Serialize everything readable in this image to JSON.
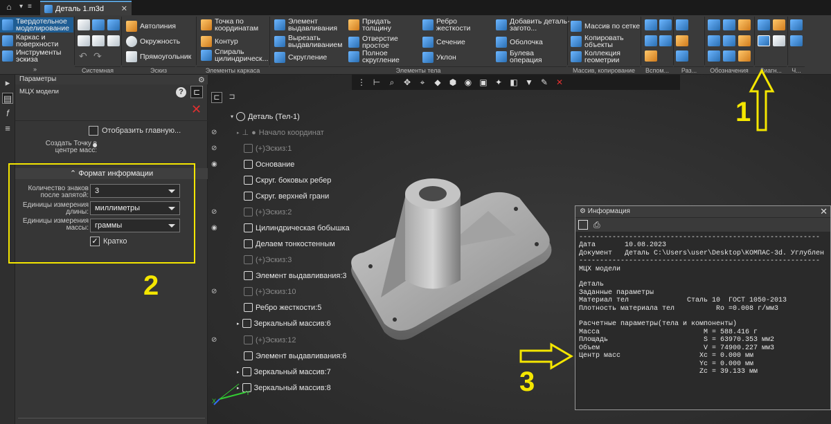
{
  "title_bar": {
    "doc_tab": "Деталь 1.m3d"
  },
  "ribbon": {
    "modes": [
      "Твердотельное моделирование",
      "Каркас и поверхности",
      "Инструменты эскиза"
    ],
    "sketch_tools": [
      "Автолиния",
      "Окружность",
      "Прямоугольник"
    ],
    "frame_tools": [
      "Точка по координатам",
      "Контур",
      "Спираль цилиндрическ..."
    ],
    "body_tools_col1": [
      "Элемент выдавливания",
      "Вырезать выдавливанием",
      "Скругление"
    ],
    "body_tools_col2": [
      "Придать толщину",
      "Отверстие простое",
      "Полное скругление"
    ],
    "body_tools_col3": [
      "Ребро жесткости",
      "Сечение",
      "Уклон"
    ],
    "body_tools_col4": [
      "Добавить деталь-загото...",
      "Оболочка",
      "Булева операция"
    ],
    "array_tools": [
      "Массив по сетке",
      "Копировать объекты",
      "Коллекция геометрии"
    ],
    "groups": [
      "Системная",
      "Эскиз",
      "Элементы каркаса",
      "Элементы тела",
      "Массив, копирование",
      "Вспом...",
      "Раз...",
      "Обозначения",
      "Диагн...",
      "Ч..."
    ]
  },
  "params": {
    "title": "Параметры",
    "subtitle": "МЦХ модели",
    "show_main": "Отобразить главную...",
    "create_point": "Создать Точку в центре масс:",
    "section": "Формат информации",
    "fields": [
      {
        "label": "Количество знаков после запятой:",
        "value": "3"
      },
      {
        "label": "Единицы измерения длины:",
        "value": "миллиметры"
      },
      {
        "label": "Единицы измерения массы:",
        "value": "граммы"
      }
    ],
    "brief": "Кратко"
  },
  "tree": {
    "root": "Деталь (Тел-1)",
    "items": [
      {
        "label": "Начало координат",
        "dim": true
      },
      {
        "label": "(+)Эскиз:1",
        "dim": true
      },
      {
        "label": "Основание",
        "dim": false
      },
      {
        "label": "Скруг. боковых ребер",
        "dim": false
      },
      {
        "label": "Скруг. верхней грани",
        "dim": false
      },
      {
        "label": "(+)Эскиз:2",
        "dim": true
      },
      {
        "label": "Цилиндрическая бобышка",
        "dim": false
      },
      {
        "label": "Делаем тонкостенным",
        "dim": false
      },
      {
        "label": "(+)Эскиз:3",
        "dim": true
      },
      {
        "label": "Элемент выдавливания:3",
        "dim": false
      },
      {
        "label": "(+)Эскиз:10",
        "dim": true
      },
      {
        "label": "Ребро жесткости:5",
        "dim": false
      },
      {
        "label": "Зеркальный массив:6",
        "dim": false
      },
      {
        "label": "(+)Эскиз:12",
        "dim": true
      },
      {
        "label": "Элемент выдавливания:6",
        "dim": false
      },
      {
        "label": "Зеркальный массив:7",
        "dim": false
      },
      {
        "label": "Зеркальный массив:8",
        "dim": false
      }
    ]
  },
  "axes": {
    "x": "X",
    "y": "Y"
  },
  "info": {
    "title": "Информация",
    "text": "----------------------------------------------------------\nДата       10.08.2023\nДокумент   Деталь C:\\Users\\user\\Desktop\\КОМПАС-3d. Углублен\n----------------------------------------------------------\nМЦХ модели\n\nДеталь\nЗаданные параметры\nМатериал тел              Сталь 10  ГОСТ 1050-2013\nПлотность материала тел          Ro =0.008 г/мм3\n\nРасчетные параметры(тела и компоненты)\nМасса                         M = 588.416 г\nПлощадь                       S = 63970.353 мм2\nОбъем                         V = 74900.227 мм3\nЦентр масс                   Xc = 0.000 мм\n                             Yc = 0.000 мм\n                             Zc = 39.133 мм"
  },
  "annotations": [
    "1",
    "2",
    "3"
  ],
  "colors": {
    "highlight": "#f4e600",
    "accent": "#1f5d93",
    "close": "#e03030"
  }
}
